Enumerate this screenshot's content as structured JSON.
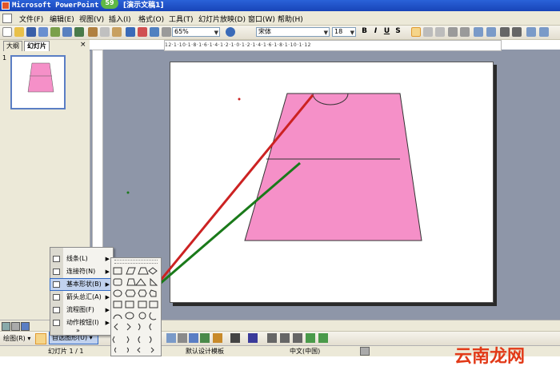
{
  "titlebar": {
    "app_title": "Microsoft PowerPoint",
    "doc_title": "[演示文稿1]",
    "badge": "59"
  },
  "menubar": {
    "items": [
      "文件(F)",
      "编辑(E)",
      "视图(V)",
      "插入(I)",
      "格式(O)",
      "工具(T)",
      "幻灯片放映(D)",
      "窗口(W)",
      "帮助(H)"
    ]
  },
  "toolbar": {
    "zoom": "65%",
    "font_name": "宋体",
    "font_size": "18",
    "bold": "B",
    "italic": "I",
    "underline": "U",
    "shadow": "S"
  },
  "left_panel": {
    "tabs": [
      "大纲",
      "幻灯片"
    ],
    "active_tab": "幻灯片",
    "slide_number": "1"
  },
  "ruler": {
    "h_ticks": "12·1·10·1·8·1·6·1·4·1·2·1·0·1·2·1·4·1·6·1·8·1·10·1·12"
  },
  "autoshapes_menu": {
    "items": [
      {
        "label": "线条(L)",
        "icon": "lines-icon"
      },
      {
        "label": "连接符(N)",
        "icon": "connector-icon"
      },
      {
        "label": "基本形状(B)",
        "icon": "basic-shapes-icon"
      },
      {
        "label": "箭头总汇(A)",
        "icon": "block-arrows-icon"
      },
      {
        "label": "流程图(F)",
        "icon": "flowchart-icon"
      },
      {
        "label": "动作按钮(I)",
        "icon": "action-buttons-icon"
      }
    ],
    "selected": "基本形状(B)",
    "more": "»"
  },
  "drawbar": {
    "draw_label": "绘图(R) ▾",
    "autoshape_label": "自选图形(U) ▾"
  },
  "statusbar": {
    "slide_info": "幻灯片 1 / 1",
    "design": "默认设计模板",
    "language": "中文(中国)"
  },
  "watermark": {
    "text": "云南龙网"
  },
  "colors": {
    "shape_fill": "#f590c8",
    "red_line": "#cc2222",
    "green_line": "#1a7a1a",
    "accent": "#316ac5"
  }
}
